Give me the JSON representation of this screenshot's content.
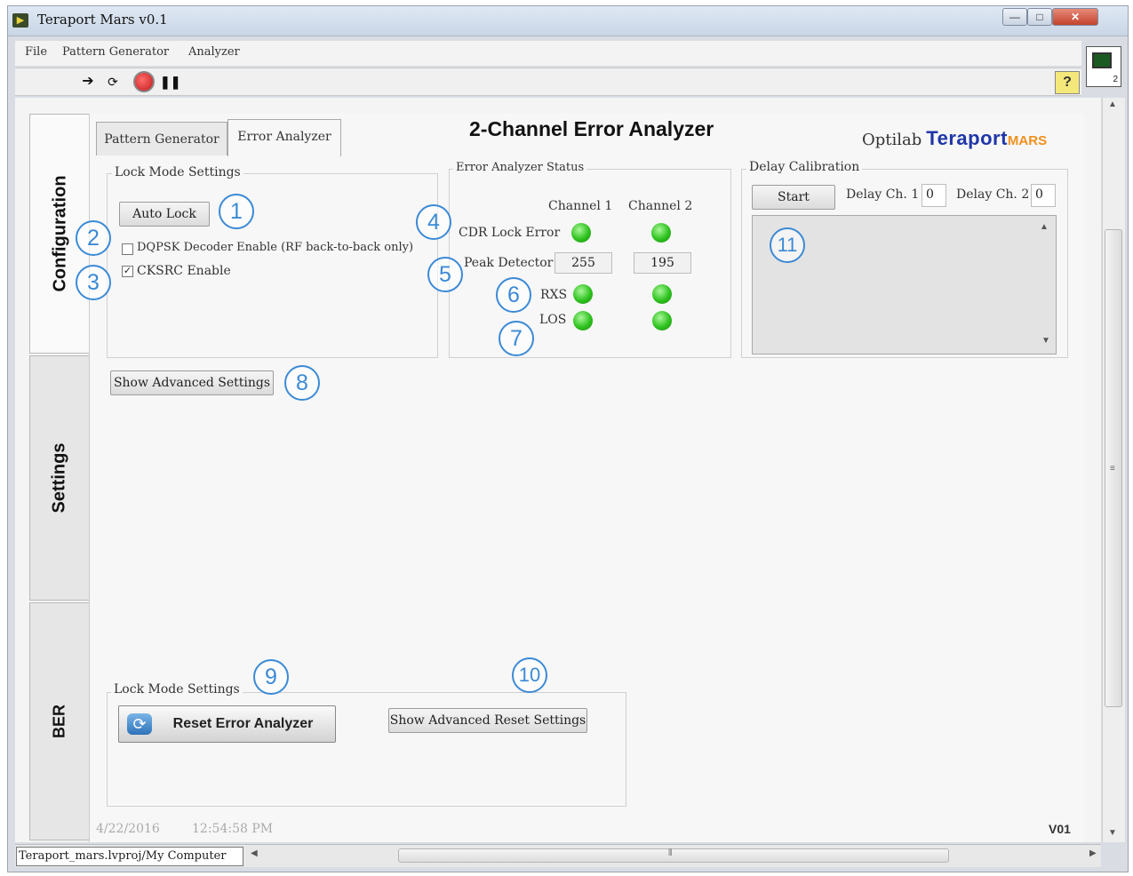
{
  "window": {
    "title": "Teraport Mars v0.1",
    "min": "—",
    "max": "□",
    "close": "✕"
  },
  "menu": [
    "File",
    "Pattern Generator",
    "Analyzer"
  ],
  "toolbar": {
    "help": "?",
    "vi_icon_label": "2"
  },
  "vertical_tabs": [
    "Configuration",
    "Settings",
    "BER"
  ],
  "tabs": [
    "Pattern Generator",
    "Error Analyzer"
  ],
  "page_title": "2-Channel Error Analyzer",
  "brand": {
    "prefix": "Optilab",
    "name": "Teraport",
    "suffix": "MARS"
  },
  "lock_mode": {
    "title": "Lock Mode Settings",
    "auto_lock_label": "Auto Lock",
    "dqpsk_label": "DQPSK Decoder Enable (RF back-to-back only)",
    "dqpsk_checked": false,
    "cksrc_label": "CKSRC Enable",
    "cksrc_checked": true
  },
  "status": {
    "title": "Error Analyzer Status",
    "channel1": "Channel 1",
    "channel2": "Channel 2",
    "cdr_lock_error": "CDR Lock Error",
    "peak_detector": "Peak Detector",
    "peak_ch1": "255",
    "peak_ch2": "195",
    "rxs": "RXS",
    "los": "LOS",
    "led_color": "#2ec21e"
  },
  "delay_cal": {
    "title": "Delay Calibration",
    "start_label": "Start",
    "delay_ch1_label": "Delay Ch. 1",
    "delay_ch1_value": "0",
    "delay_ch2_label": "Delay Ch. 2",
    "delay_ch2_value": "0"
  },
  "advanced": {
    "show_advanced_settings": "Show Advanced Settings"
  },
  "reset_group": {
    "title": "Lock Mode Settings",
    "reset_label": "Reset Error Analyzer",
    "show_advanced_reset": "Show Advanced Reset Settings"
  },
  "callouts": [
    "1",
    "2",
    "3",
    "4",
    "5",
    "6",
    "7",
    "8",
    "9",
    "10",
    "11"
  ],
  "callout_color": "#3b8ad6",
  "statusbar": {
    "date": "4/22/2016",
    "time": "12:54:58 PM",
    "version": "V01"
  },
  "bottom": {
    "project_path": "Teraport_mars.lvproj/My Computer"
  }
}
